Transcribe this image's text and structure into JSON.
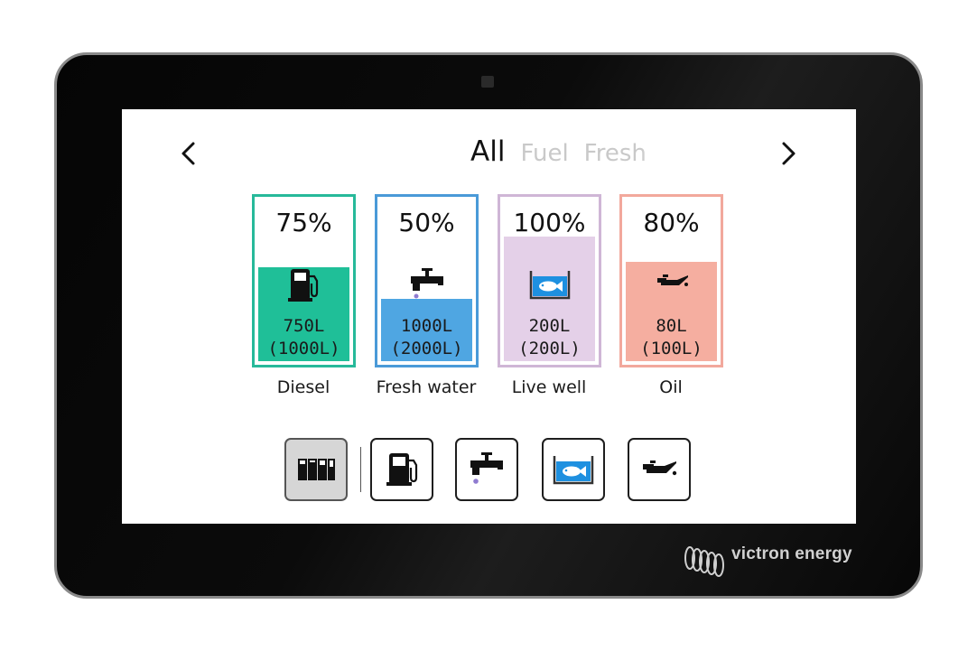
{
  "device": {
    "brand": "victron energy"
  },
  "header": {
    "prev_icon": "chevron-left-icon",
    "next_icon": "chevron-right-icon",
    "tabs": [
      {
        "label": "All",
        "active": true
      },
      {
        "label": "Fuel",
        "active": false
      },
      {
        "label": "Fresh",
        "active": false
      }
    ]
  },
  "tanks": [
    {
      "name": "Diesel",
      "percent_label": "75%",
      "level": 0.75,
      "volume": "750L",
      "capacity": "(1000L)",
      "icon": "fuel-pump-icon",
      "border_color": "#27b99a",
      "fill_color": "#1fbf98"
    },
    {
      "name": "Fresh water",
      "percent_label": "50%",
      "level": 0.5,
      "volume": "1000L",
      "capacity": "(2000L)",
      "icon": "water-tap-icon",
      "border_color": "#4a9ad8",
      "fill_color": "#4fa6e2"
    },
    {
      "name": "Live well",
      "percent_label": "100%",
      "level": 1.0,
      "volume": "200L",
      "capacity": "(200L)",
      "icon": "fish-tank-icon",
      "border_color": "#cfb6d6",
      "fill_color": "#e4d0e8"
    },
    {
      "name": "Oil",
      "percent_label": "80%",
      "level": 0.8,
      "volume": "80L",
      "capacity": "(100L)",
      "icon": "oil-can-icon",
      "border_color": "#f2a89c",
      "fill_color": "#f5aea0"
    }
  ],
  "filters": [
    {
      "icon": "all-tanks-icon",
      "active": true
    },
    {
      "icon": "fuel-pump-icon",
      "active": false
    },
    {
      "icon": "water-tap-icon",
      "active": false
    },
    {
      "icon": "fish-tank-icon",
      "active": false
    },
    {
      "icon": "oil-can-icon",
      "active": false
    }
  ]
}
